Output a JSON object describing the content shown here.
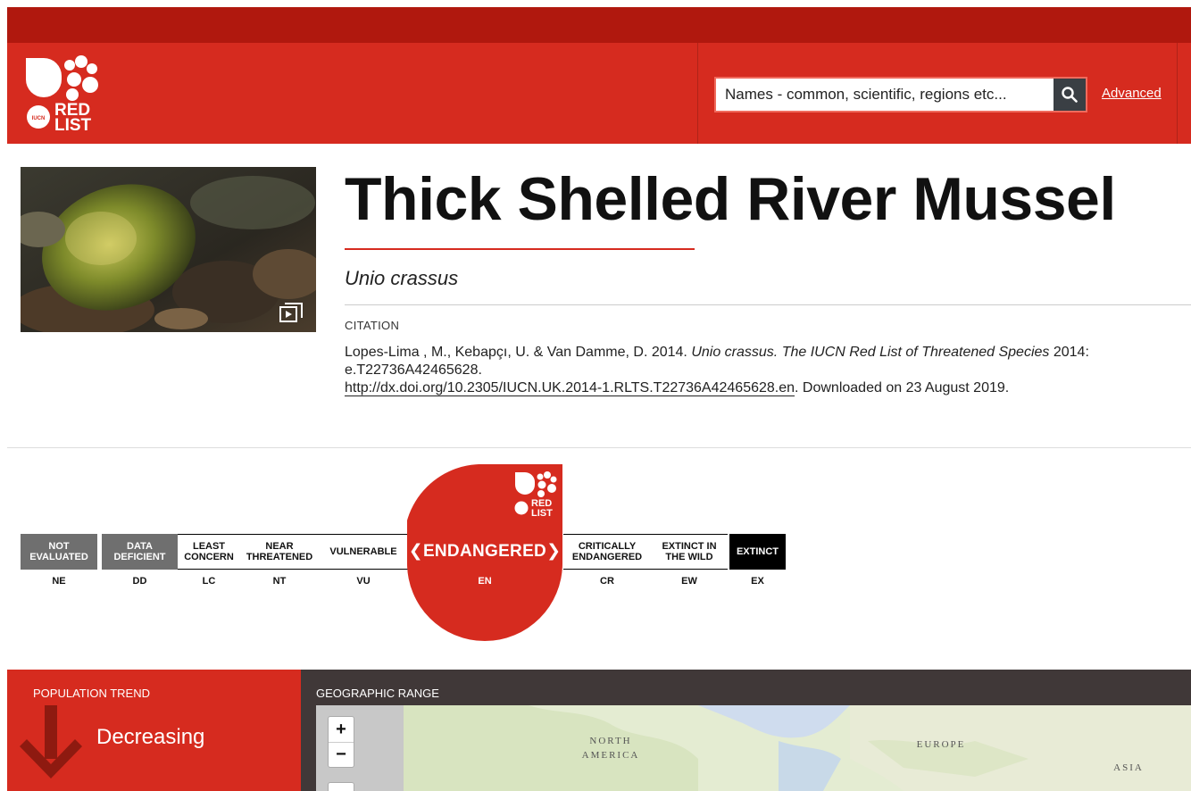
{
  "header": {
    "logo_text": "RED LIST",
    "logo_badge": "IUCN",
    "search_placeholder": "Names - common, scientific, regions etc...",
    "advanced_label": "Advanced"
  },
  "species": {
    "common_name": "Thick Shelled River Mussel",
    "scientific_name": "Unio crassus",
    "citation_label": "CITATION",
    "citation_authors": "Lopes-Lima , M., Kebapçı, U. & Van Damme, D. 2014. ",
    "citation_italic": "Unio crassus. The IUCN Red List of Threatened Species",
    "citation_rest": " 2014: e.T22736A42465628.",
    "citation_doi": "http://dx.doi.org/10.2305/IUCN.UK.2014-1.RLTS.T22736A42465628.en",
    "citation_downloaded": ". Downloaded on 23 August 2019."
  },
  "categories": [
    {
      "label": "NOT EVALUATED",
      "code": "NE"
    },
    {
      "label": "DATA DEFICIENT",
      "code": "DD"
    },
    {
      "label": "LEAST CONCERN",
      "code": "LC"
    },
    {
      "label": "NEAR THREATENED",
      "code": "NT"
    },
    {
      "label": "VULNERABLE",
      "code": "VU"
    },
    {
      "label": "ENDANGERED",
      "code": "EN"
    },
    {
      "label": "CRITICALLY ENDANGERED",
      "code": "CR"
    },
    {
      "label": "EXTINCT IN THE WILD",
      "code": "EW"
    },
    {
      "label": "EXTINCT",
      "code": "EX"
    }
  ],
  "selected_category": {
    "label": "ENDANGERED",
    "code": "EN",
    "color": "#d62b1f"
  },
  "population_trend": {
    "label": "POPULATION TREND",
    "value": "Decreasing"
  },
  "geographic_range": {
    "label": "GEOGRAPHIC RANGE",
    "zoom_in": "+",
    "zoom_out": "−",
    "map_labels": [
      "NORTH",
      "AMERICA",
      "EUROPE",
      "ASIA"
    ]
  },
  "colors": {
    "brand_red": "#d62b1f",
    "dark_red": "#b0180e",
    "dark_panel": "#403838"
  }
}
